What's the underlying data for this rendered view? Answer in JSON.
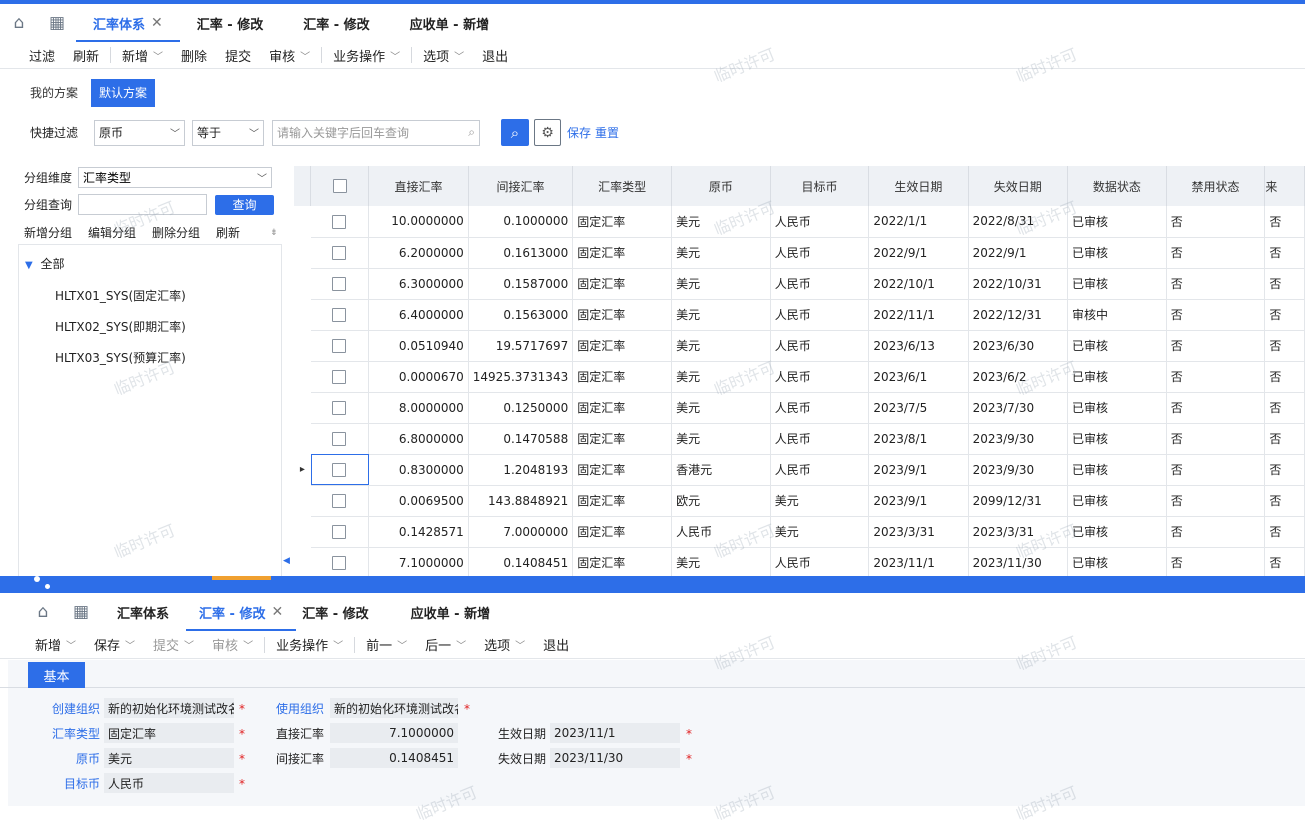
{
  "watermark": "临时许可",
  "top": {
    "tabs": [
      {
        "label": "汇率体系",
        "active": true,
        "closable": true
      },
      {
        "label": "汇率 - 修改"
      },
      {
        "label": "汇率 - 修改"
      },
      {
        "label": "应收单 - 新增"
      }
    ],
    "toolbar": [
      {
        "label": "过滤"
      },
      {
        "label": "刷新"
      },
      {
        "label": "新增",
        "dd": true
      },
      {
        "label": "删除"
      },
      {
        "label": "提交"
      },
      {
        "label": "审核",
        "dd": true
      },
      {
        "label": "业务操作",
        "dd": true
      },
      {
        "label": "选项",
        "dd": true
      },
      {
        "label": "退出"
      }
    ],
    "schemes": {
      "mine": "我的方案",
      "default": "默认方案"
    },
    "quick_filter": {
      "label": "快捷过滤",
      "field": "原币",
      "op": "等于",
      "placeholder": "请输入关键字后回车查询",
      "save": "保存",
      "reset": "重置"
    },
    "group": {
      "dim_label": "分组维度",
      "dim_value": "汇率类型",
      "query_label": "分组查询",
      "query_button": "查询",
      "actions": [
        "新增分组",
        "编辑分组",
        "删除分组",
        "刷新"
      ],
      "root": "全部",
      "children": [
        "HLTX01_SYS(固定汇率)",
        "HLTX02_SYS(即期汇率)",
        "HLTX03_SYS(预算汇率)"
      ]
    },
    "grid": {
      "columns": [
        "直接汇率",
        "间接汇率",
        "汇率类型",
        "原币",
        "目标币",
        "生效日期",
        "失效日期",
        "数据状态",
        "禁用状态",
        "来"
      ],
      "rows": [
        [
          "10.0000000",
          "0.1000000",
          "固定汇率",
          "美元",
          "人民币",
          "2022/1/1",
          "2022/8/31",
          "已审核",
          "否",
          "否"
        ],
        [
          "6.2000000",
          "0.1613000",
          "固定汇率",
          "美元",
          "人民币",
          "2022/9/1",
          "2022/9/1",
          "已审核",
          "否",
          "否"
        ],
        [
          "6.3000000",
          "0.1587000",
          "固定汇率",
          "美元",
          "人民币",
          "2022/10/1",
          "2022/10/31",
          "已审核",
          "否",
          "否"
        ],
        [
          "6.4000000",
          "0.1563000",
          "固定汇率",
          "美元",
          "人民币",
          "2022/11/1",
          "2022/12/31",
          "审核中",
          "否",
          "否"
        ],
        [
          "0.0510940",
          "19.5717697",
          "固定汇率",
          "美元",
          "人民币",
          "2023/6/13",
          "2023/6/30",
          "已审核",
          "否",
          "否"
        ],
        [
          "0.0000670",
          "14925.3731343",
          "固定汇率",
          "美元",
          "人民币",
          "2023/6/1",
          "2023/6/2",
          "已审核",
          "否",
          "否"
        ],
        [
          "8.0000000",
          "0.1250000",
          "固定汇率",
          "美元",
          "人民币",
          "2023/7/5",
          "2023/7/30",
          "已审核",
          "否",
          "否"
        ],
        [
          "6.8000000",
          "0.1470588",
          "固定汇率",
          "美元",
          "人民币",
          "2023/8/1",
          "2023/9/30",
          "已审核",
          "否",
          "否"
        ],
        [
          "0.8300000",
          "1.2048193",
          "固定汇率",
          "香港元",
          "人民币",
          "2023/9/1",
          "2023/9/30",
          "已审核",
          "否",
          "否"
        ],
        [
          "0.0069500",
          "143.8848921",
          "固定汇率",
          "欧元",
          "美元",
          "2023/9/1",
          "2099/12/31",
          "已审核",
          "否",
          "否"
        ],
        [
          "0.1428571",
          "7.0000000",
          "固定汇率",
          "人民币",
          "美元",
          "2023/3/31",
          "2023/3/31",
          "已审核",
          "否",
          "否"
        ],
        [
          "7.1000000",
          "0.1408451",
          "固定汇率",
          "美元",
          "人民币",
          "2023/11/1",
          "2023/11/30",
          "已审核",
          "否",
          "否"
        ]
      ]
    }
  },
  "bottom": {
    "tabs": [
      {
        "label": "汇率体系"
      },
      {
        "label": "汇率 - 修改",
        "active": true,
        "closable": true
      },
      {
        "label": "汇率 - 修改"
      },
      {
        "label": "应收单 - 新增"
      }
    ],
    "toolbar": [
      {
        "label": "新增",
        "dd": true
      },
      {
        "label": "保存",
        "dd": true
      },
      {
        "label": "提交",
        "dd": true,
        "disabled": true
      },
      {
        "label": "审核",
        "dd": true,
        "disabled": true
      },
      {
        "label": "业务操作",
        "dd": true
      },
      {
        "label": "前一",
        "dd": true
      },
      {
        "label": "后一",
        "dd": true
      },
      {
        "label": "选项",
        "dd": true
      },
      {
        "label": "退出"
      }
    ],
    "form_tab": "基本",
    "form": {
      "create_org_label": "创建组织",
      "create_org_value": "新的初始化环境测试改名",
      "use_org_label": "使用组织",
      "use_org_value": "新的初始化环境测试改名",
      "rate_type_label": "汇率类型",
      "rate_type_value": "固定汇率",
      "direct_label": "直接汇率",
      "direct_value": "7.1000000",
      "effective_label": "生效日期",
      "effective_value": "2023/11/1",
      "currency_label": "原币",
      "currency_value": "美元",
      "indirect_label": "间接汇率",
      "indirect_value": "0.1408451",
      "expire_label": "失效日期",
      "expire_value": "2023/11/30",
      "target_label": "目标币",
      "target_value": "人民币",
      "req": "*"
    }
  }
}
